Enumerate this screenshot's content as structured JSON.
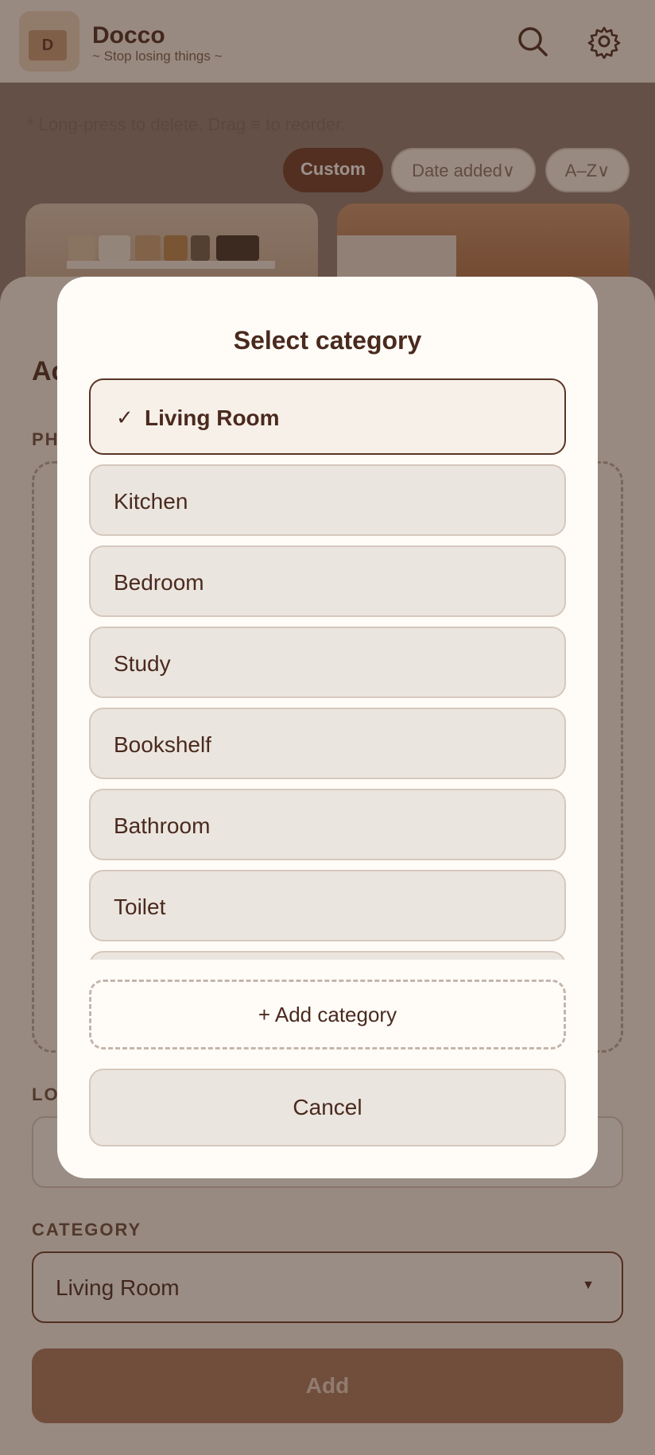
{
  "app": {
    "title": "Docco",
    "subtitle": "~ Stop losing things ~",
    "logo_letter": "D"
  },
  "toolbar": {
    "hint": "* Long-press to delete. Drag ≡ to reorder.",
    "sort_custom": "Custom",
    "sort_date": "Date added∨",
    "sort_az": "A–Z∨"
  },
  "form": {
    "title": "Ac",
    "photo_label": "PH",
    "location_label": "LO",
    "category_label": "CATEGORY",
    "category_value": "Living Room",
    "category_arrow": "▼",
    "add_label": "Add"
  },
  "modal": {
    "title": "Select category",
    "selected_check": "✓",
    "options": [
      {
        "label": "Living Room",
        "selected": true
      },
      {
        "label": "Kitchen",
        "selected": false
      },
      {
        "label": "Bedroom",
        "selected": false
      },
      {
        "label": "Study",
        "selected": false
      },
      {
        "label": "Bookshelf",
        "selected": false
      },
      {
        "label": "Bathroom",
        "selected": false
      },
      {
        "label": "Toilet",
        "selected": false
      },
      {
        "label": "",
        "selected": false
      }
    ],
    "add_category": "+ Add category",
    "cancel": "Cancel"
  },
  "colors": {
    "accent": "#6b3b29",
    "background": "#f7f0e9",
    "text": "#4a2a1e"
  }
}
